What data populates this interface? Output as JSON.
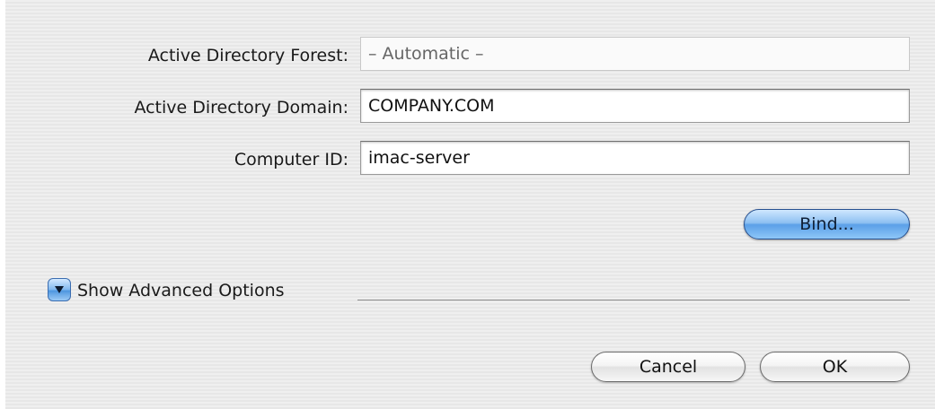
{
  "form": {
    "forest_label": "Active Directory Forest:",
    "forest_value": "– Automatic –",
    "domain_label": "Active Directory Domain:",
    "domain_value": "COMPANY.COM",
    "computer_id_label": "Computer ID:",
    "computer_id_value": "imac-server"
  },
  "bind_button": "Bind...",
  "advanced": {
    "label": "Show Advanced Options",
    "icon": "disclosure-triangle-icon",
    "expanded": false
  },
  "footer": {
    "cancel": "Cancel",
    "ok": "OK"
  },
  "colors": {
    "accent": "#5ba0e8",
    "background": "#ececec"
  }
}
